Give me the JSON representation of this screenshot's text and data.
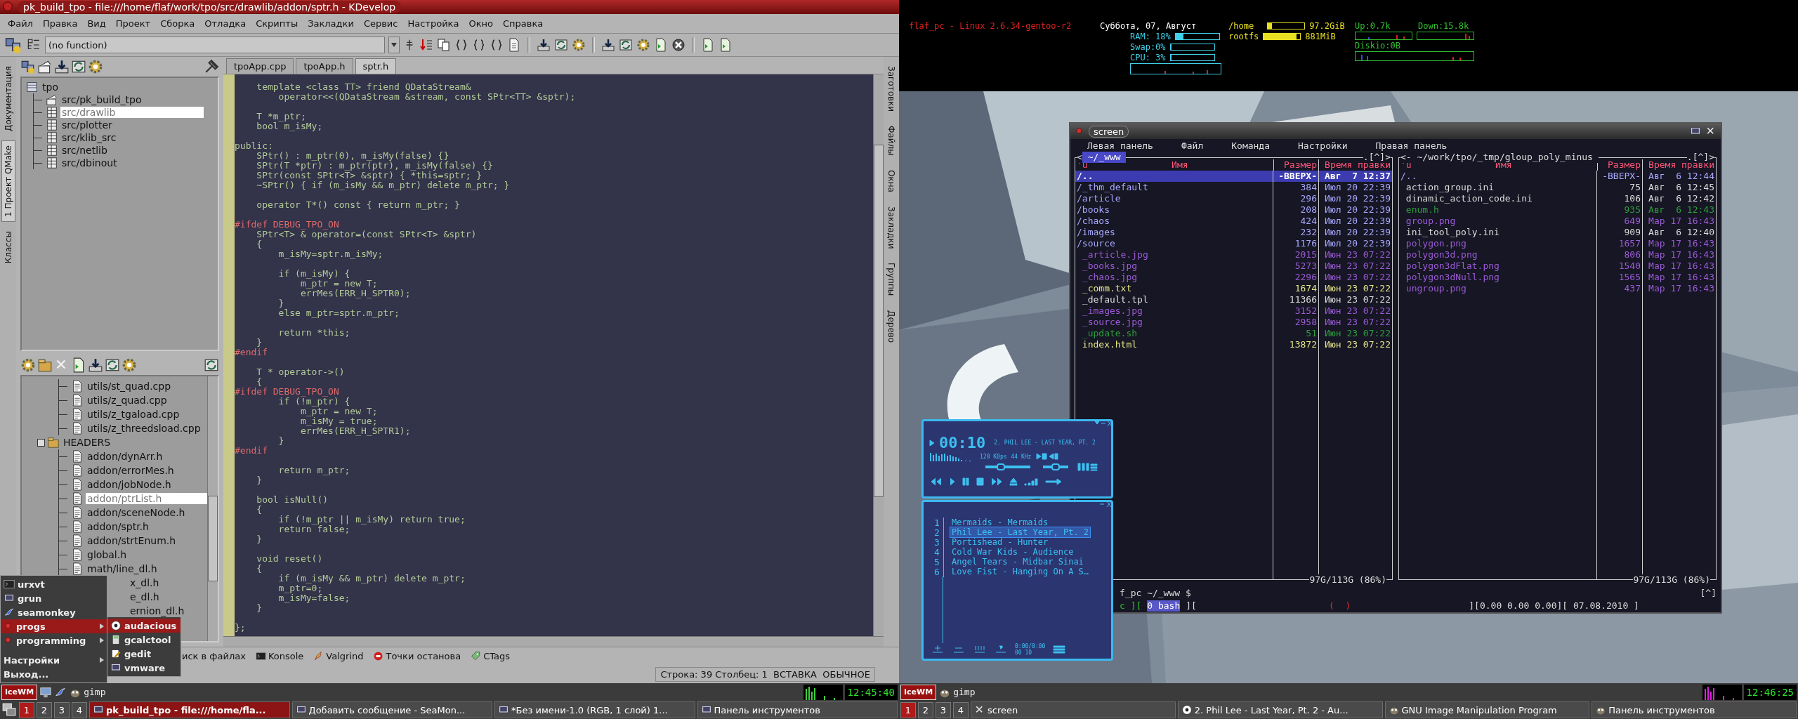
{
  "left_screen": {
    "window": {
      "title": "pk_build_tpo - file:///home/flaf/work/tpo/src/drawlib/addon/sptr.h - KDevelop"
    },
    "menu": [
      "Файл",
      "Правка",
      "Вид",
      "Проект",
      "Сборка",
      "Отладка",
      "Скрипты",
      "Закладки",
      "Сервис",
      "Настройка",
      "Окно",
      "Справка"
    ],
    "function_combo": {
      "value": "(no function)"
    },
    "left_tabs": [
      {
        "label": "Документация",
        "selected": false
      },
      {
        "label": "1 Проект QMake",
        "selected": true
      },
      {
        "label": "Классы",
        "selected": false
      }
    ],
    "project_tree": {
      "label": "tpo",
      "selected": false,
      "children": [
        {
          "label": "src/pk_build_tpo",
          "kind": "target",
          "selected": false
        },
        {
          "label": "src/drawlib",
          "kind": "lib",
          "selected": true
        },
        {
          "label": "src/plotter",
          "kind": "lib",
          "selected": false
        },
        {
          "label": "src/klib_src",
          "kind": "lib",
          "selected": false
        },
        {
          "label": "src/netlib",
          "kind": "lib",
          "selected": false
        },
        {
          "label": "src/dbinout",
          "kind": "lib",
          "selected": false
        }
      ]
    },
    "file_tree": {
      "scrolled_parent_children": [
        {
          "label": "utils/st_quad.cpp",
          "kind": "file",
          "selected": false
        },
        {
          "label": "utils/z_quad.cpp",
          "kind": "file",
          "selected": false
        },
        {
          "label": "utils/z_tgaload.cpp",
          "kind": "file",
          "selected": false
        },
        {
          "label": "utils/z_threedsload.cpp",
          "kind": "file",
          "selected": false
        }
      ],
      "folders": [
        {
          "label": "HEADERS",
          "children": [
            {
              "label": "addon/dynArr.h",
              "kind": "file",
              "selected": false
            },
            {
              "label": "addon/errorMes.h",
              "kind": "file",
              "selected": false
            },
            {
              "label": "addon/jobNode.h",
              "kind": "file",
              "selected": false
            },
            {
              "label": "addon/ptrList.h",
              "kind": "file",
              "selected": true
            },
            {
              "label": "addon/sceneNode.h",
              "kind": "file",
              "selected": false
            },
            {
              "label": "addon/sptr.h",
              "kind": "file",
              "selected": false
            },
            {
              "label": "addon/strtEnum.h",
              "kind": "file",
              "selected": false
            },
            {
              "label": "global.h",
              "kind": "file",
              "selected": false
            },
            {
              "label": "math/line_dl.h",
              "kind": "file",
              "selected": false
            },
            {
              "label": "x_dl.h",
              "kind": "covered",
              "selected": false
            },
            {
              "label": "e_dl.h",
              "kind": "covered",
              "selected": false
            },
            {
              "label": "ernion_dl.h",
              "kind": "covered",
              "selected": false
            }
          ]
        }
      ]
    },
    "editor_tabs": [
      {
        "label": "tpoApp.cpp",
        "selected": false
      },
      {
        "label": "tpoApp.h",
        "selected": false
      },
      {
        "label": "sptr.h",
        "selected": true
      }
    ],
    "code_lines": [
      {
        "kind": "code",
        "text": "    template <class TT> friend QDataStream&"
      },
      {
        "kind": "code",
        "text": "        operator<<(QDataStream &stream, const SPtr<TT> &sptr);"
      },
      {
        "kind": "blank"
      },
      {
        "kind": "code",
        "text": "    T *m_ptr;"
      },
      {
        "kind": "code",
        "text": "    bool m_isMy;"
      },
      {
        "kind": "blank"
      },
      {
        "kind": "code",
        "text": "public:"
      },
      {
        "kind": "code",
        "text": "    SPtr() : m_ptr(0), m_isMy(false) {}"
      },
      {
        "kind": "code",
        "text": "    SPtr(T *ptr) : m_ptr(ptr), m_isMy(false) {}"
      },
      {
        "kind": "code",
        "text": "    SPtr(const SPtr<T> &sptr) { *this=sptr; }"
      },
      {
        "kind": "code",
        "text": "    ~SPtr() { if (m_isMy && m_ptr) delete m_ptr; }"
      },
      {
        "kind": "blank"
      },
      {
        "kind": "code",
        "text": "    operator T*() const { return m_ptr; }"
      },
      {
        "kind": "blank"
      },
      {
        "kind": "directive",
        "text": "#ifdef DEBUG_TPO_ON"
      },
      {
        "kind": "code",
        "text": "    SPtr<T> & operator=(const SPtr<T> &sptr)"
      },
      {
        "kind": "code",
        "text": "    {"
      },
      {
        "kind": "code",
        "text": "        m_isMy=sptr.m_isMy;"
      },
      {
        "kind": "blank"
      },
      {
        "kind": "code",
        "text": "        if (m_isMy) {"
      },
      {
        "kind": "code",
        "text": "            m_ptr = new T;"
      },
      {
        "kind": "code",
        "text": "            errMes(ERR_H_SPTR0);"
      },
      {
        "kind": "code",
        "text": "        }"
      },
      {
        "kind": "code",
        "text": "        else m_ptr=sptr.m_ptr;"
      },
      {
        "kind": "blank"
      },
      {
        "kind": "code",
        "text": "        return *this;"
      },
      {
        "kind": "code",
        "text": "    }"
      },
      {
        "kind": "directive",
        "text": "#endif"
      },
      {
        "kind": "blank"
      },
      {
        "kind": "code",
        "text": "    T * operator->()"
      },
      {
        "kind": "code",
        "text": "    {"
      },
      {
        "kind": "directive",
        "text": "#ifdef DEBUG_TPO_ON"
      },
      {
        "kind": "code",
        "text": "        if (!m_ptr) {"
      },
      {
        "kind": "code",
        "text": "            m_ptr = new T;"
      },
      {
        "kind": "code",
        "text": "            m_isMy = true;"
      },
      {
        "kind": "code",
        "text": "            errMes(ERR_H_SPTR1);"
      },
      {
        "kind": "code",
        "text": "        }"
      },
      {
        "kind": "directive",
        "text": "#endif"
      },
      {
        "kind": "blank"
      },
      {
        "kind": "code",
        "text": "        return m_ptr;"
      },
      {
        "kind": "code",
        "text": "    }"
      },
      {
        "kind": "blank"
      },
      {
        "kind": "code",
        "text": "    bool isNull()"
      },
      {
        "kind": "code",
        "text": "    {"
      },
      {
        "kind": "code",
        "text": "        if (!m_ptr || m_isMy) return true;"
      },
      {
        "kind": "code",
        "text": "        return false;"
      },
      {
        "kind": "code",
        "text": "    }"
      },
      {
        "kind": "blank"
      },
      {
        "kind": "code",
        "text": "    void reset()"
      },
      {
        "kind": "code",
        "text": "    {"
      },
      {
        "kind": "code",
        "text": "        if (m_isMy && m_ptr) delete m_ptr;"
      },
      {
        "kind": "code",
        "text": "        m_ptr=0;"
      },
      {
        "kind": "code",
        "text": "        m_isMy=false;"
      },
      {
        "kind": "code",
        "text": "    }"
      },
      {
        "kind": "blank"
      },
      {
        "kind": "code",
        "text": "};"
      }
    ],
    "right_tabs": [
      {
        "label": "Заготовки",
        "selected": false
      },
      {
        "label": "Файлы",
        "selected": false
      },
      {
        "label": "Окна",
        "selected": false
      },
      {
        "label": "Закладки",
        "selected": false
      },
      {
        "label": "Группы",
        "selected": false
      },
      {
        "label": "Дерево",
        "selected": false
      }
    ],
    "bottom_tabs": [
      {
        "label": "иск в файлах",
        "kind": "covered",
        "selected": false
      },
      {
        "label": "Konsole",
        "kind": "terminal",
        "selected": false
      },
      {
        "label": "Valgrind",
        "kind": "rocket",
        "selected": false
      },
      {
        "label": "Точки останова",
        "kind": "stop",
        "selected": false
      },
      {
        "label": "CTags",
        "kind": "tag",
        "selected": false
      }
    ],
    "status": "Строка: 39 Столбец: 1  ВСТАВКА  ОБЫЧНОЕ",
    "start_menu": {
      "items": [
        {
          "label": "urxvt",
          "kind": "app",
          "selected": false
        },
        {
          "label": "grun",
          "kind": "app",
          "selected": false
        },
        {
          "label": "seamonkey",
          "kind": "app",
          "selected": false
        },
        {
          "label": "progs",
          "kind": "submenu",
          "selected": true
        },
        {
          "label": "programming",
          "kind": "submenu",
          "selected": false
        },
        {
          "label": "Настройки",
          "kind": "submenu",
          "selected": false
        },
        {
          "label": "Выход...",
          "kind": "app",
          "selected": false
        }
      ],
      "submenu": [
        {
          "label": "audacious",
          "selected": true
        },
        {
          "label": "gcalctool",
          "selected": false
        },
        {
          "label": "gedit",
          "selected": false
        },
        {
          "label": "vmware",
          "selected": false
        }
      ]
    },
    "taskbar": {
      "logo": "IceWM",
      "launcher": "gimp",
      "clock": "12:45:40",
      "workspaces": [
        {
          "label": "1",
          "selected": true
        },
        {
          "label": "2",
          "selected": false
        },
        {
          "label": "3",
          "selected": false
        },
        {
          "label": "4",
          "selected": false
        }
      ],
      "tasks": [
        {
          "label": "pk_build_tpo - file:///home/fla...",
          "selected": true
        },
        {
          "label": "Добавить сообщение - SeaMon...",
          "selected": false
        },
        {
          "label": "*Без имени-1.0 (RGB, 1 слой) 1...",
          "selected": false
        },
        {
          "label": "Панель инструментов",
          "selected": false
        }
      ]
    }
  },
  "right_screen": {
    "conky": {
      "system": "flaf_pc - Linux 2.6.34-gentoo-r2",
      "date": "Суббота, 07, Август",
      "meters": [
        {
          "label": "RAM: 18%",
          "level": 0.18
        },
        {
          "label": "Swap:0%",
          "level": 0
        },
        {
          "label": "CPU: 3%",
          "level": 0.03
        }
      ],
      "disks": [
        {
          "label": "/home",
          "level": 0.12,
          "reading": "97.2GiB"
        },
        {
          "label": "rootfs",
          "level": 0.9,
          "reading": "881MiB"
        }
      ],
      "up": "Up:0.7k",
      "down": "Down:15.8k",
      "diskio": "Diskio:0B"
    },
    "screen_window": {
      "title": "screen",
      "menu": [
        "Левая панель",
        "Файл",
        "Команда",
        "Настройки",
        "Правая панель"
      ],
      "panels": [
        {
          "prefix": "<",
          "path": "~/_www",
          "suffix": ".[^]>",
          "active": true,
          "sort_mark": "'u",
          "columns": [
            "Имя",
            "Размер",
            "Время правки"
          ],
          "footer": "97G/113G (86%)",
          "rows": [
            {
              "name": "/..",
              "size": "-ВВЕРХ-",
              "date": "Авг  7 12:37",
              "selected": true
            },
            {
              "name": "/_thm_default",
              "size": "384",
              "date": "Июл 20 22:39",
              "color": "#a8a8ff",
              "selected": false
            },
            {
              "name": "/article",
              "size": "296",
              "date": "Июл 20 22:39",
              "color": "#a8a8ff",
              "selected": false
            },
            {
              "name": "/books",
              "size": "208",
              "date": "Июл 20 22:39",
              "color": "#a8a8ff",
              "selected": false
            },
            {
              "name": "/chaos",
              "size": "424",
              "date": "Июл 20 22:39",
              "color": "#a8a8ff",
              "selected": false
            },
            {
              "name": "/images",
              "size": "232",
              "date": "Июл 20 22:39",
              "color": "#a8a8ff",
              "selected": false
            },
            {
              "name": "/source",
              "size": "1176",
              "date": "Июл 20 22:39",
              "color": "#a8a8ff",
              "selected": false
            },
            {
              "name": " _article.jpg",
              "size": "2015",
              "date": "Июн 23 07:22",
              "color": "#9b5bd6",
              "selected": false
            },
            {
              "name": " _books.jpg",
              "size": "5273",
              "date": "Июн 23 07:22",
              "color": "#9b5bd6",
              "selected": false
            },
            {
              "name": " _chaos.jpg",
              "size": "2296",
              "date": "Июн 23 07:22",
              "color": "#9b5bd6",
              "selected": false
            },
            {
              "name": " _comm.txt",
              "size": "1674",
              "date": "Июн 23 07:22",
              "color": "#e6e68a",
              "selected": false
            },
            {
              "name": " _default.tpl",
              "size": "11366",
              "date": "Июн 23 07:22",
              "color": "#dddddd",
              "selected": false
            },
            {
              "name": " _images.jpg",
              "size": "3152",
              "date": "Июн 23 07:22",
              "color": "#9b5bd6",
              "selected": false
            },
            {
              "name": " _source.jpg",
              "size": "2958",
              "date": "Июн 23 07:22",
              "color": "#9b5bd6",
              "selected": false
            },
            {
              "name": " _update.sh",
              "size": "51",
              "date": "Июн 23 07:22",
              "color": "#2e9e3e",
              "selected": false
            },
            {
              "name": " index.html",
              "size": "13872",
              "date": "Июн 23 07:22",
              "color": "#e6e68a",
              "selected": false
            }
          ]
        },
        {
          "prefix": "<-",
          "path": "~/work/tpo/_tmp/gloup_poly_minus",
          "suffix": ".[^]>",
          "active": false,
          "sort_mark": "'u",
          "columns": [
            "Имя",
            "Размер",
            "Время правки"
          ],
          "footer": "97G/113G (86%)",
          "rows": [
            {
              "name": "/..",
              "size": "-ВВЕРХ-",
              "date": "Авг  6 12:44",
              "color": "#a8a8ff",
              "selected": false
            },
            {
              "name": " action_group.ini",
              "size": "75",
              "date": "Авг  6 12:45",
              "color": "#dddddd",
              "selected": false
            },
            {
              "name": " dinamic_action_code.ini",
              "size": "106",
              "date": "Авг  6 12:42",
              "color": "#dddddd",
              "selected": false
            },
            {
              "name": " enum.h",
              "size": "935",
              "date": "Авг  6 12:43",
              "color": "#2e9e3e",
              "selected": false
            },
            {
              "name": " group.png",
              "size": "649",
              "date": "Мар 17 16:43",
              "color": "#9b5bd6",
              "selected": false
            },
            {
              "name": " ini_tool_poly.ini",
              "size": "909",
              "date": "Авг  6 12:40",
              "color": "#dddddd",
              "selected": false
            },
            {
              "name": " polygon.png",
              "size": "1657",
              "date": "Мар 17 16:43",
              "color": "#9b5bd6",
              "selected": false
            },
            {
              "name": " polygon3d.png",
              "size": "806",
              "date": "Мар 17 16:43",
              "color": "#9b5bd6",
              "selected": false
            },
            {
              "name": " polygon3dFlat.png",
              "size": "1540",
              "date": "Мар 17 16:43",
              "color": "#9b5bd6",
              "selected": false
            },
            {
              "name": " polygon3dNull.png",
              "size": "1565",
              "date": "Мар 17 16:43",
              "color": "#9b5bd6",
              "selected": false
            },
            {
              "name": " ungroup.png",
              "size": "437",
              "date": "Мар 17 16:43",
              "color": "#9b5bd6",
              "selected": false
            }
          ]
        }
      ],
      "prompt": "f_pc ~/_www $",
      "prompt_mark": "[^]",
      "status_parts": [
        {
          "text": "c ][",
          "kind": "plain"
        },
        {
          "text": "0 bash",
          "kind": "window"
        },
        {
          "text": "][",
          "kind": "plain"
        },
        {
          "text": "(  )",
          "kind": "alert"
        },
        {
          "text": "][0.00 0.00 0.00][ 07.08.2010 ]",
          "kind": "plain"
        }
      ]
    },
    "player": {
      "time": "00:10",
      "track": "2. PHIL LEE - LAST YEAR, PT. 2",
      "bitrate": "128 KBps",
      "samplerate": "44 KHz",
      "volume": {
        "level": 0.34
      },
      "balance": {
        "level": 0.5
      }
    },
    "playlist": {
      "entries": [
        {
          "number": "1",
          "title": "Mermaids - Mermaids",
          "selected": false
        },
        {
          "number": "2",
          "title": "Phil Lee - Last Year, Pt. 2",
          "selected": true
        },
        {
          "number": "3",
          "title": "Portishead - Hunter",
          "selected": false
        },
        {
          "number": "4",
          "title": "Cold War Kids - Audience",
          "selected": false
        },
        {
          "number": "5",
          "title": "Angel Tears - Midbar Sinai",
          "selected": false
        },
        {
          "number": "6",
          "title": "Love Fist - Hanging On A S…",
          "selected": false
        }
      ],
      "time": "0:00/0:00",
      "counter": "00 10"
    },
    "taskbar": {
      "logo": "IceWM",
      "launcher": "gimp",
      "clock": "12:46:25",
      "workspaces": [
        {
          "label": "1",
          "selected": true
        },
        {
          "label": "2",
          "selected": false
        },
        {
          "label": "3",
          "selected": false
        },
        {
          "label": "4",
          "selected": false
        }
      ],
      "tasks": [
        {
          "label": "screen",
          "kind": "terminal",
          "selected": false
        },
        {
          "label": "2. Phil Lee - Last Year, Pt. 2 - Au...",
          "kind": "player",
          "selected": false
        },
        {
          "label": "GNU Image Manipulation Program",
          "kind": "gimp",
          "selected": false
        },
        {
          "label": "Панель инструментов",
          "kind": "gimp",
          "selected": false
        }
      ]
    }
  }
}
